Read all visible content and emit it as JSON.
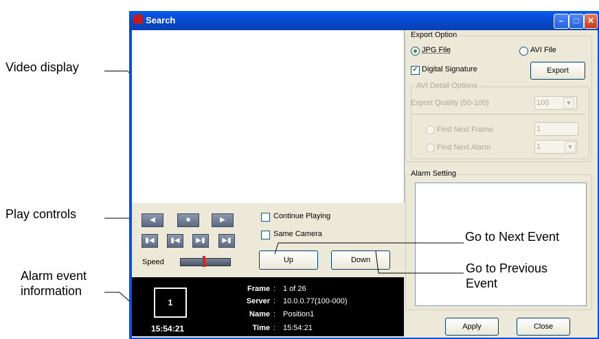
{
  "callouts": {
    "video_display": "Video display",
    "play_controls": "Play controls",
    "alarm_event_line1": "Alarm event",
    "alarm_event_line2": "information",
    "next_event": "Go to Next Event",
    "prev_event_line1": "Go to Previous",
    "prev_event_line2": "Event"
  },
  "window": {
    "title": "Search"
  },
  "playback": {
    "continue_playing": "Continue Playing",
    "same_camera": "Same Camera",
    "speed_label": "Speed",
    "up_label": "Up",
    "down_label": "Down"
  },
  "event_info": {
    "camera_number": "1",
    "time_display": "15:54:21",
    "labels": {
      "frame": "Frame",
      "server": "Server",
      "name": "Name",
      "time": "Time"
    },
    "separator": ":",
    "values": {
      "frame": "1 of 26",
      "server": "10.0.0.77(100-000)",
      "name": "Position1",
      "time": "15:54:21"
    }
  },
  "export_option": {
    "group_label": "Export Option",
    "jpg_label": "JPG File",
    "avi_label": "AVI File",
    "digital_signature": "Digital Signature",
    "export_button": "Export",
    "avi_details": {
      "group_label": "AVI Detail Options",
      "quality_label": "Export Quality (50-100)",
      "quality_value": "100",
      "find_next_frame": "Find Next Frame",
      "find_next_frame_value": "1",
      "find_next_alarm": "Find Next Alarm",
      "find_next_alarm_value": "1"
    }
  },
  "alarm_setting": {
    "group_label": "Alarm Setting"
  },
  "footer": {
    "apply": "Apply",
    "close": "Close"
  }
}
